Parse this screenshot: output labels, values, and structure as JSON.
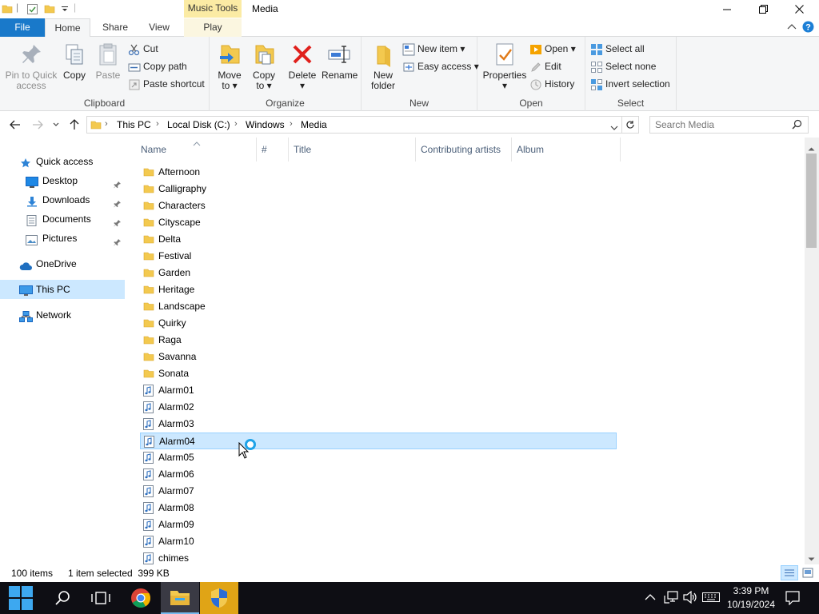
{
  "window": {
    "title": "Media",
    "context_tab_group": "Music Tools"
  },
  "ribbon_tabs": {
    "file": "File",
    "home": "Home",
    "share": "Share",
    "view": "View",
    "play": "Play"
  },
  "ribbon": {
    "clipboard": {
      "label": "Clipboard",
      "pin_line1": "Pin to Quick",
      "pin_line2": "access",
      "copy": "Copy",
      "paste": "Paste",
      "cut": "Cut",
      "copy_path": "Copy path",
      "paste_shortcut": "Paste shortcut"
    },
    "organize": {
      "label": "Organize",
      "move_line1": "Move",
      "move_line2": "to",
      "copy_line1": "Copy",
      "copy_line2": "to",
      "delete": "Delete",
      "rename": "Rename"
    },
    "new": {
      "label": "New",
      "new_folder_line1": "New",
      "new_folder_line2": "folder",
      "new_item": "New item",
      "easy_access": "Easy access"
    },
    "open": {
      "label": "Open",
      "properties": "Properties",
      "open": "Open",
      "edit": "Edit",
      "history": "History"
    },
    "select": {
      "label": "Select",
      "select_all": "Select all",
      "select_none": "Select none",
      "invert_selection": "Invert selection"
    }
  },
  "address_bar": {
    "crumbs": [
      "This PC",
      "Local Disk (C:)",
      "Windows",
      "Media"
    ],
    "search_placeholder": "Search Media"
  },
  "nav_pane": {
    "quick_access": "Quick access",
    "desktop": "Desktop",
    "downloads": "Downloads",
    "documents": "Documents",
    "pictures": "Pictures",
    "onedrive": "OneDrive",
    "this_pc": "This PC",
    "network": "Network"
  },
  "columns": {
    "name": "Name",
    "number": "#",
    "title": "Title",
    "contributing_artists": "Contributing artists",
    "album": "Album"
  },
  "files": [
    {
      "name": "Afternoon",
      "type": "folder"
    },
    {
      "name": "Calligraphy",
      "type": "folder"
    },
    {
      "name": "Characters",
      "type": "folder"
    },
    {
      "name": "Cityscape",
      "type": "folder"
    },
    {
      "name": "Delta",
      "type": "folder"
    },
    {
      "name": "Festival",
      "type": "folder"
    },
    {
      "name": "Garden",
      "type": "folder"
    },
    {
      "name": "Heritage",
      "type": "folder"
    },
    {
      "name": "Landscape",
      "type": "folder"
    },
    {
      "name": "Quirky",
      "type": "folder"
    },
    {
      "name": "Raga",
      "type": "folder"
    },
    {
      "name": "Savanna",
      "type": "folder"
    },
    {
      "name": "Sonata",
      "type": "folder"
    },
    {
      "name": "Alarm01",
      "type": "audio"
    },
    {
      "name": "Alarm02",
      "type": "audio"
    },
    {
      "name": "Alarm03",
      "type": "audio"
    },
    {
      "name": "Alarm04",
      "type": "audio",
      "selected": true
    },
    {
      "name": "Alarm05",
      "type": "audio"
    },
    {
      "name": "Alarm06",
      "type": "audio"
    },
    {
      "name": "Alarm07",
      "type": "audio"
    },
    {
      "name": "Alarm08",
      "type": "audio"
    },
    {
      "name": "Alarm09",
      "type": "audio"
    },
    {
      "name": "Alarm10",
      "type": "audio"
    },
    {
      "name": "chimes",
      "type": "audio"
    }
  ],
  "status": {
    "item_count": "100 items",
    "selection": "1 item selected  399 KB"
  },
  "taskbar": {
    "time": "3:39 PM",
    "date": "10/19/2024"
  },
  "colors": {
    "file_tab": "#1979ca",
    "selection_bg": "#cce8ff",
    "selection_border": "#99d1ff",
    "context_tab": "#fbeba4",
    "taskbar": "#0e0e14"
  }
}
